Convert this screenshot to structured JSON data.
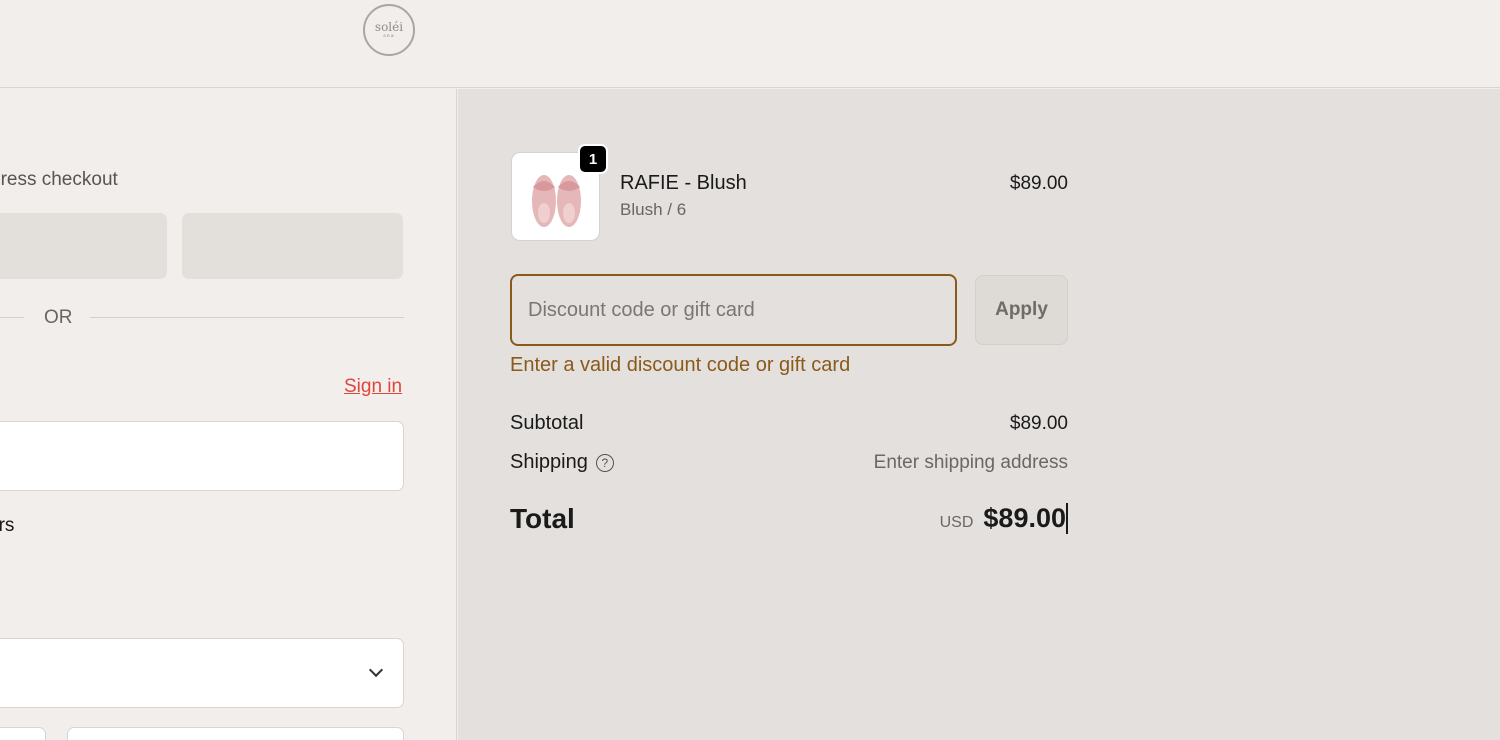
{
  "header": {
    "logo_text": "soléi",
    "logo_sub": "sea"
  },
  "checkout": {
    "express_label": "press checkout",
    "or_label": "OR",
    "signin_link": "Sign in",
    "newsletter_fragment": "ers"
  },
  "summary": {
    "product": {
      "name": "RAFIE - Blush",
      "variant": "Blush / 6",
      "price": "$89.00",
      "quantity": "1",
      "image_icon": "sandals-image"
    },
    "discount": {
      "placeholder": "Discount code or gift card",
      "apply_label": "Apply",
      "error": "Enter a valid discount code or gift card"
    },
    "subtotal_label": "Subtotal",
    "subtotal_value": "$89.00",
    "shipping_label": "Shipping",
    "shipping_value": "Enter shipping address",
    "total_label": "Total",
    "currency": "USD",
    "total_value": "$89.00"
  },
  "colors": {
    "accent_error": "#8a5a1b",
    "link": "#e0463e",
    "panel_bg": "#e4e0dd",
    "page_bg": "#f1eeeb"
  }
}
